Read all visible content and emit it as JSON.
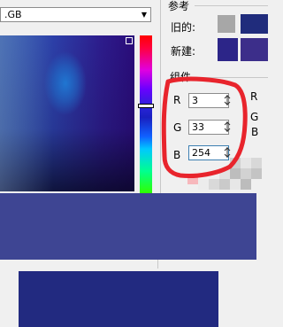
{
  "colors": {
    "old_swatch": "#a7a7a7",
    "new_swatch": "#2c2588",
    "old_swatch_right": "#202c7c",
    "new_swatch_right": "#3c2e8a",
    "big_swatch_1": "#3e4593",
    "big_swatch_2": "#222a80",
    "annotation": "#e8242c"
  },
  "color_model": {
    "selected": ".GB"
  },
  "reference": {
    "title": "参考",
    "old_label": "旧的:",
    "new_label": "新建:"
  },
  "components": {
    "title": "组件",
    "r_label": "R",
    "g_label": "G",
    "b_label": "B",
    "r_value": "3",
    "g_value": "33",
    "b_value": "254",
    "right_r": "R",
    "right_g": "G",
    "right_b": "B"
  },
  "icons": {
    "dropdown": "chevron-down-icon",
    "spin": "spin-arrows-icon"
  }
}
